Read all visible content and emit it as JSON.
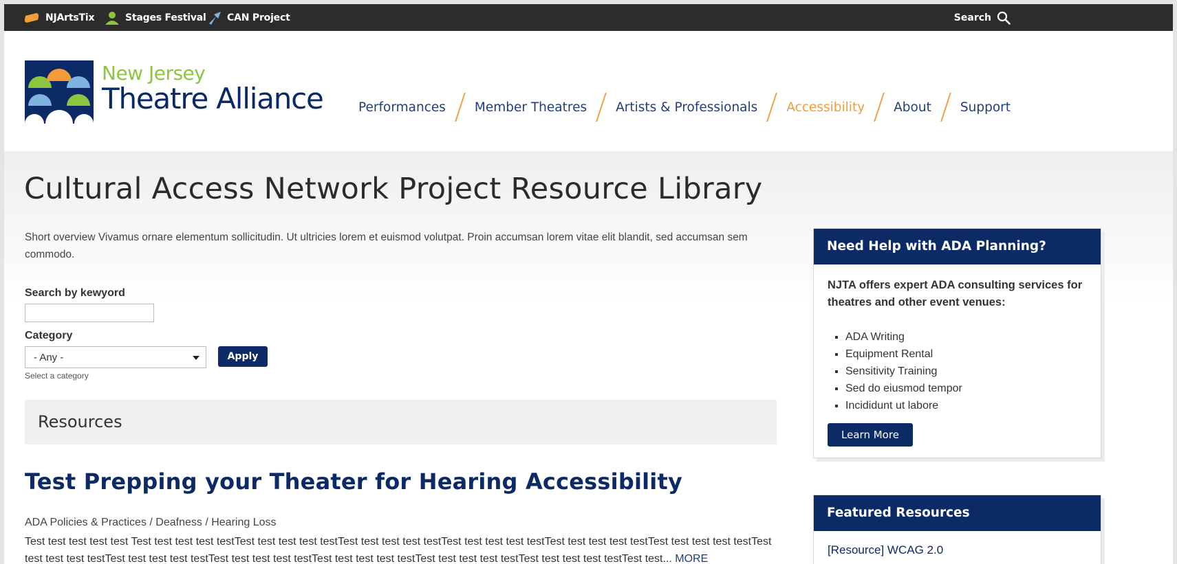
{
  "topbar": {
    "links": [
      {
        "label": "NJArtsTix",
        "icon": "ticket-icon"
      },
      {
        "label": "Stages Festival",
        "icon": "person-icon"
      },
      {
        "label": "CAN Project",
        "icon": "arrow-icon"
      }
    ],
    "search_label": "Search"
  },
  "logo": {
    "line1": "New Jersey",
    "line2": "Theatre Alliance"
  },
  "nav": {
    "items": [
      "Performances",
      "Member Theatres",
      "Artists & Professionals",
      "Accessibility",
      "About",
      "Support"
    ],
    "active": "Accessibility"
  },
  "page": {
    "title": "Cultural Access Network Project Resource Library",
    "overview": "Short overview Vivamus ornare elementum sollicitudin. Ut ultricies lorem et euismod volutpat. Proin accumsan lorem vitae elit blandit, sed accumsan sem commodo."
  },
  "filters": {
    "keyword_label": "Search by kewyord",
    "keyword_value": "",
    "category_label": "Category",
    "category_value": "- Any -",
    "category_hint": "Select a category",
    "apply_label": "Apply"
  },
  "resources": {
    "heading": "Resources",
    "item": {
      "title": "Test Prepping your Theater for Hearing Accessibility",
      "categories": "ADA Policies & Practices / Deafness / Hearing Loss",
      "excerpt": "Test test test test test Test test test test testTest test test test testTest test test test testTest test test test testTest test test test testTest test test test testTest test test test testTest test test test testTest test test test testTest test test test testTest test test test testTest test test test testTest test...",
      "more_label": "MORE"
    }
  },
  "sidebar": {
    "ada": {
      "heading": "Need Help with ADA Planning?",
      "intro": "NJTA offers expert ADA consulting services for theatres and other event venues:",
      "items": [
        "ADA Writing",
        "Equipment Rental",
        "Sensitivity Training",
        "Sed do eiusmod tempor",
        "Incididunt ut labore"
      ],
      "button_label": "Learn More"
    },
    "featured": {
      "heading": "Featured Resources",
      "first_link": "[Resource] WCAG 2.0"
    }
  },
  "colors": {
    "navy": "#0b2a66",
    "accent_orange": "#f39c3a",
    "logo_green": "#8cc63f",
    "topbar": "#2c2c2c"
  }
}
